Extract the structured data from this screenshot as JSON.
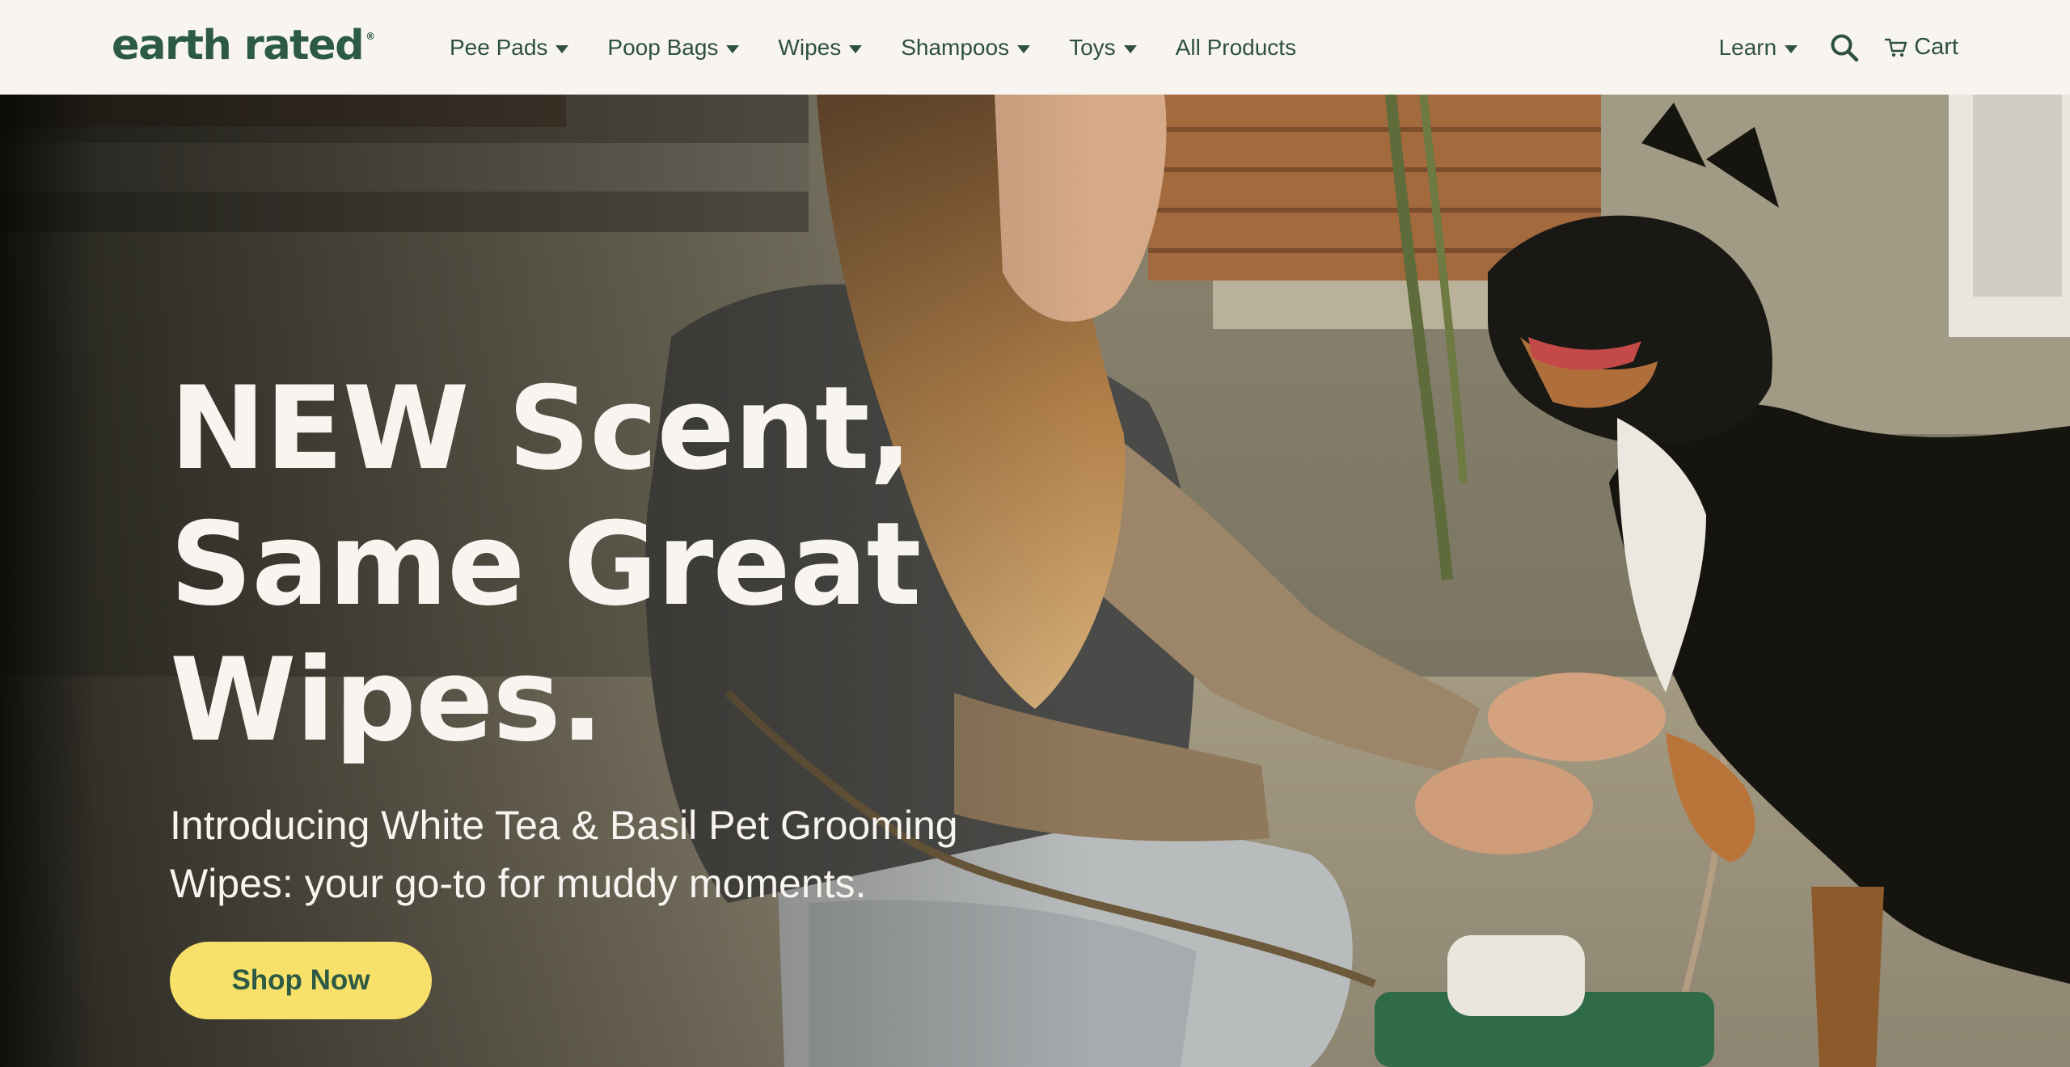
{
  "brand": {
    "name": "earth rated",
    "registered": "®",
    "color": "#2c5a44"
  },
  "nav": {
    "items": [
      {
        "label": "Pee Pads",
        "dropdown": true
      },
      {
        "label": "Poop Bags",
        "dropdown": true
      },
      {
        "label": "Wipes",
        "dropdown": true
      },
      {
        "label": "Shampoos",
        "dropdown": true
      },
      {
        "label": "Toys",
        "dropdown": true
      },
      {
        "label": "All Products",
        "dropdown": false
      }
    ],
    "learn": "Learn",
    "search_icon": "search-icon",
    "cart_icon": "cart-icon",
    "cart": "Cart"
  },
  "hero": {
    "title_lines": [
      "NEW Scent,",
      "Same Great",
      "Wipes."
    ],
    "subtitle": "Introducing White Tea & Basil Pet Grooming Wipes: your go-to for muddy moments.",
    "cta": "Shop Now",
    "cta_color": "#f7e16a",
    "text_color": "#f8f5f0"
  }
}
